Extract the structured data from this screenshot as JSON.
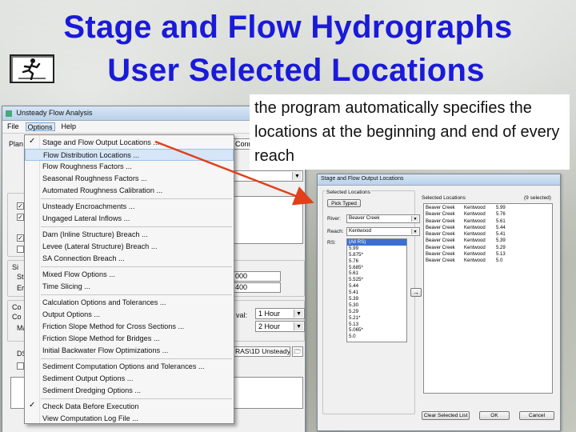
{
  "slide": {
    "title_line1": "Stage and Flow Hydrographs",
    "title_line2": "User Selected Locations",
    "callout": "the program automatically specifies the locations at the beginning and end of every reach",
    "title_color": "#1a1ad9",
    "arrow_color": "#e0401a"
  },
  "main_window": {
    "title": "Unsteady Flow Analysis",
    "menus": [
      "File",
      "Options",
      "Help"
    ],
    "fragments": {
      "plan_label": "Plan",
      "conn_text": "Conn",
      "sim_label": "Si",
      "st_label": "St",
      "en_label": "Er",
      "sim_value1": "000",
      "sim_value2": "400",
      "co_label": "Co",
      "c2_label": "Co",
      "ma_label": "Ma",
      "ds_label": "DS",
      "interval_label": "val:",
      "interval1": "1 Hour",
      "interval2": "2 Hour",
      "path_text": "RAS\\1D Unsteady"
    }
  },
  "options_menu": {
    "items": [
      {
        "label": "Stage and Flow Output Locations ...",
        "checked": true
      },
      {
        "label": "Flow Distribution Locations ...",
        "checked": false
      },
      {
        "label": "Flow Roughness Factors ...",
        "checked": false
      },
      {
        "label": "Seasonal Roughness Factors ...",
        "checked": false
      },
      {
        "label": "Automated Roughness Calibration ...",
        "checked": false
      },
      {
        "label": "Unsteady Encroachments ...",
        "checked": false
      },
      {
        "label": "Ungaged Lateral Inflows ...",
        "checked": false
      },
      {
        "label": "Dam (Inline Structure) Breach ...",
        "checked": false
      },
      {
        "label": "Levee (Lateral Structure) Breach ...",
        "checked": false
      },
      {
        "label": "SA Connection Breach ...",
        "checked": false
      },
      {
        "label": "Mixed Flow Options ...",
        "checked": false
      },
      {
        "label": "Time Slicing ...",
        "checked": false
      },
      {
        "label": "Calculation Options and Tolerances ...",
        "checked": false
      },
      {
        "label": "Output Options ...",
        "checked": false
      },
      {
        "label": "Friction Slope Method for Cross Sections ...",
        "checked": false
      },
      {
        "label": "Friction Slope Method for Bridges ...",
        "checked": false
      },
      {
        "label": "Initial Backwater Flow Optimizations ...",
        "checked": false
      },
      {
        "label": "Sediment Computation Options and Tolerances ...",
        "checked": false
      },
      {
        "label": "Sediment Output Options ...",
        "checked": false
      },
      {
        "label": "Sediment Dredging Options ...",
        "checked": false
      },
      {
        "label": "Check Data Before Execution",
        "checked": true
      },
      {
        "label": "View Computation Log File ...",
        "checked": false
      }
    ]
  },
  "output_dialog": {
    "title": "Stage and Flow Output Locations",
    "selected_locations_group": "Selected Locations",
    "pick_typed_button": "Pick Typed",
    "river_label": "River:",
    "river_value": "Beaver Creek",
    "reach_label": "Reach:",
    "reach_value": "Kentwood",
    "rs_label": "RS:",
    "rs_items": [
      "(All RS)",
      "5.99",
      "5.875*",
      "5.76",
      "5.685*",
      "5.61",
      "5.525*",
      "5.44",
      "5.41",
      "5.39",
      "5.30",
      "5.29",
      "5.21*",
      "5.13",
      "5.065*",
      "5.0"
    ],
    "selected_header": "Selected Locations",
    "selected_count": "(9 selected)",
    "selected": [
      {
        "river": "Beaver Creek",
        "reach": "Kentwood",
        "rs": "5.99"
      },
      {
        "river": "Beaver Creek",
        "reach": "Kentwood",
        "rs": "5.76"
      },
      {
        "river": "Beaver Creek",
        "reach": "Kentwood",
        "rs": "5.61"
      },
      {
        "river": "Beaver Creek",
        "reach": "Kentwood",
        "rs": "5.44"
      },
      {
        "river": "Beaver Creek",
        "reach": "Kentwood",
        "rs": "5.41"
      },
      {
        "river": "Beaver Creek",
        "reach": "Kentwood",
        "rs": "5.39"
      },
      {
        "river": "Beaver Creek",
        "reach": "Kentwood",
        "rs": "5.29"
      },
      {
        "river": "Beaver Creek",
        "reach": "Kentwood",
        "rs": "5.13"
      },
      {
        "river": "Beaver Creek",
        "reach": "Kentwood",
        "rs": "5.0"
      }
    ],
    "add_button": "→",
    "clear_button": "Clear Selected List",
    "ok_button": "OK",
    "cancel_button": "Cancel"
  }
}
